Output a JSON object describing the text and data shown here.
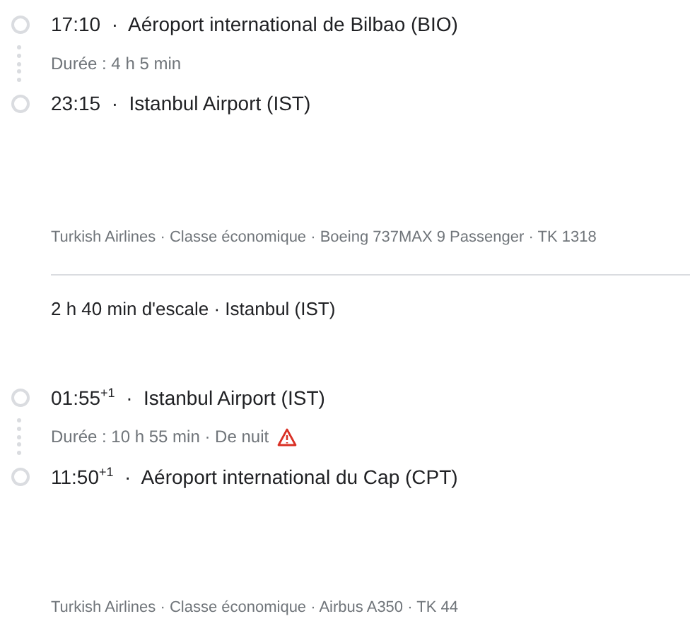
{
  "legs": [
    {
      "departure": "17:10  ·  Aéroport international de Bilbao (BIO)",
      "duration": "Durée : 4 h 5 min",
      "overnight_warning": false,
      "arrival": "23:15  ·  Istanbul Airport (IST)",
      "details": "Turkish Airlines · Classe économique · Boeing 737MAX 9 Passenger · TK 1318"
    },
    {
      "departure": "01:55$^{+1}$  ·  Istanbul Airport (IST)",
      "duration": "Durée : 10 h 55 min · De nuit",
      "overnight_warning": true,
      "arrival": "11:50$^{+1}$  ·  Aéroport international du Cap (CPT)",
      "details": "Turkish Airlines · Classe économique · Airbus A350 · TK 44"
    }
  ],
  "layover": "2 h 40 min d'escale · Istanbul (IST)"
}
